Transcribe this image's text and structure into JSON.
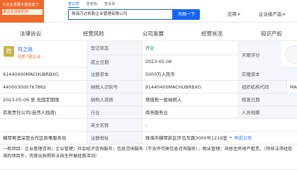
{
  "header": {
    "banner_line1": "小企业发展子基金旗下",
    "banner_line2": "事企业征信机构",
    "search_tabs": [
      "查公司",
      "查老板",
      "查关系"
    ],
    "search_value": "珠海万达凯勒企业管理有限公司",
    "search_button": "天眼一下",
    "nav": [
      "应用",
      "企业级产品"
    ]
  },
  "tabs": [
    "法律诉讼",
    "经营风险",
    "公司发展",
    "经营状况",
    "知识产权"
  ],
  "person": {
    "avatar_char": "符",
    "name": "符之晓",
    "link": "任职7家企业"
  },
  "rows": {
    "status_label": "登记状态",
    "status_value": "开业",
    "rating_label": "天眼评分",
    "established_label": "成立日期",
    "established_value": "2023-05-06",
    "credit_code": "91440400MACHUBRBXG",
    "reg_capital_label": "注册资本",
    "reg_capital_value": "5000万人民币",
    "paid_capital_label": "实缴资本",
    "reg_no": "440003000767862",
    "taxpayer_id_label": "纳税人识别号",
    "taxpayer_id_value": "91440400MACHUBRBXG",
    "org_code_label": "组织机构代码",
    "org_code_value": "MA",
    "term": "2023-05-06 至 无固定期限",
    "taxpayer_qual_label": "纳税人资质",
    "taxpayer_qual_value": "增值税一般纳税人",
    "approve_label": "核准日期",
    "company_type": "有限责任公司(自然人独资)",
    "industry_label": "行业",
    "industry_value": "商务服务业",
    "staff_label": "人员规模",
    "en_name_label": "英文名称",
    "en_name_value": "-",
    "reg_authority": "横琴粤澳深度合作区商事服务局",
    "address_label": "注册地址",
    "address_value": "珠海市横琴新区环岛东路3000号1219室",
    "nearby": "附近公司",
    "scope_value": "一般项目：企业管理咨询；企业管理；社会经济咨询服务；信息咨询服务（不含许可类信息咨询服务）；物业管理；非居住房地产租赁。（除依法须经批准的项目外，凭营业执照依法自主开展经营活动）"
  },
  "colors": {
    "brand": "#1566f0",
    "accent": "#f0692b"
  }
}
